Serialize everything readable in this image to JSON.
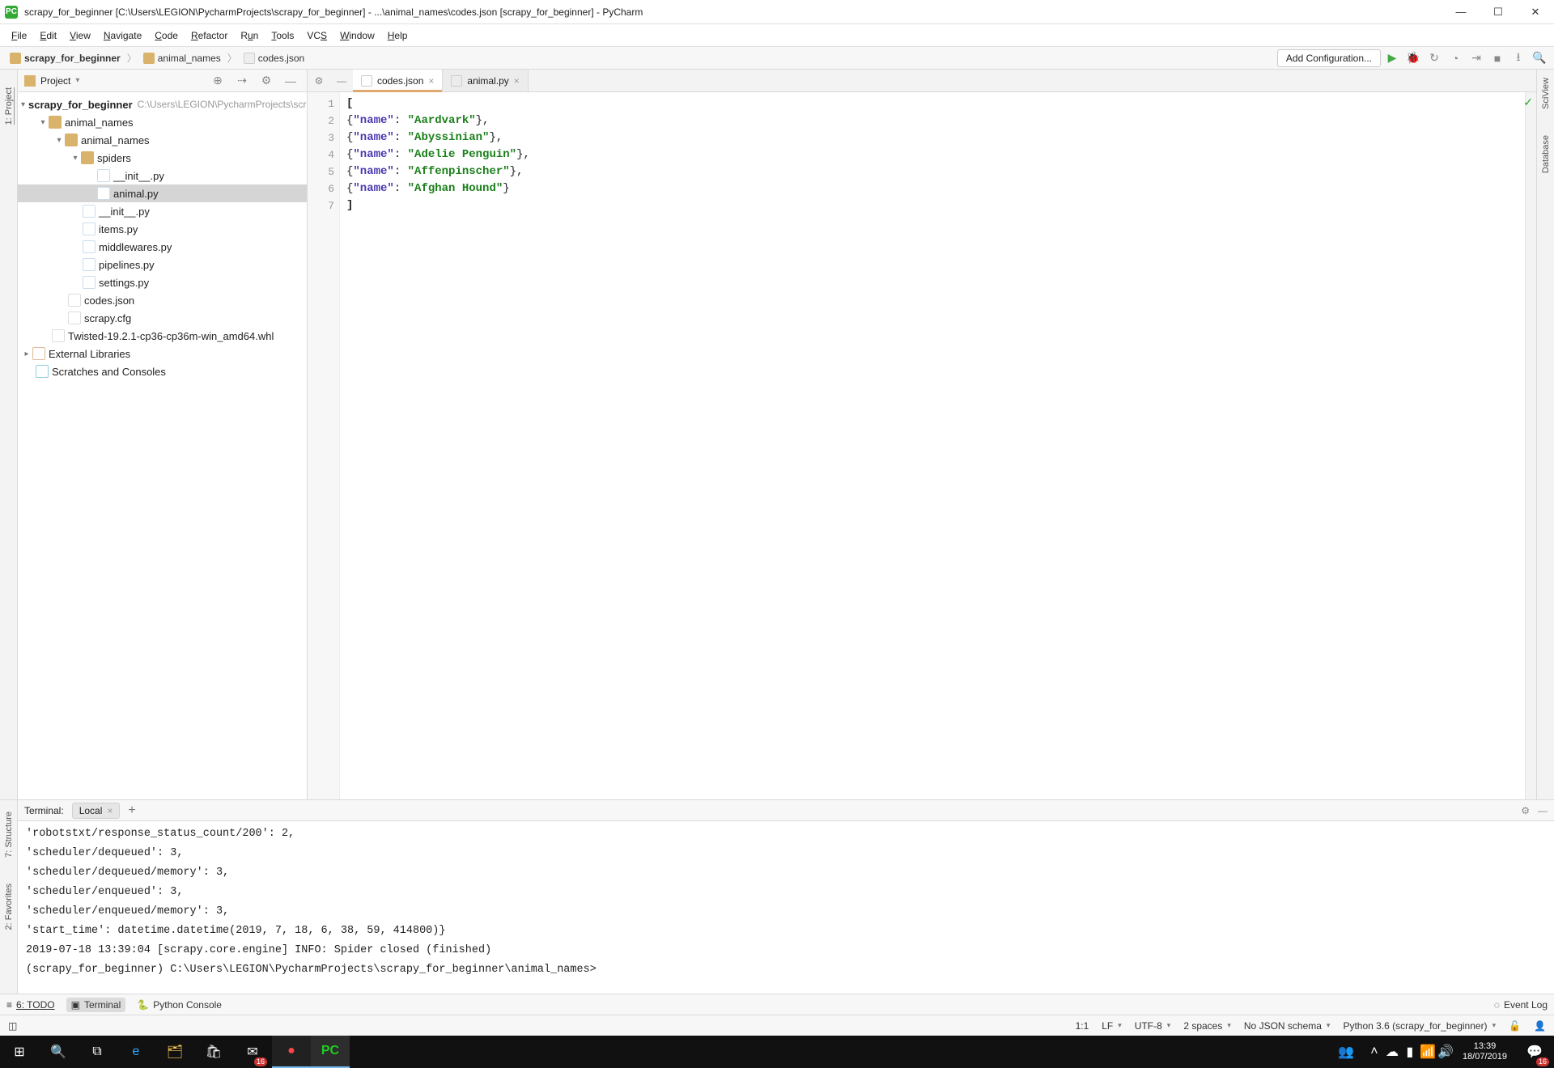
{
  "titlebar": {
    "appicon": "PC",
    "text": "scrapy_for_beginner [C:\\Users\\LEGION\\PycharmProjects\\scrapy_for_beginner] - ...\\animal_names\\codes.json [scrapy_for_beginner] - PyCharm"
  },
  "menu": [
    "File",
    "Edit",
    "View",
    "Navigate",
    "Code",
    "Refactor",
    "Run",
    "Tools",
    "VCS",
    "Window",
    "Help"
  ],
  "breadcrumb": {
    "root": "scrapy_for_beginner",
    "mid": "animal_names",
    "file": "codes.json",
    "addconf": "Add Configuration..."
  },
  "left_gutter": {
    "project": "1: Project"
  },
  "right_gutter": {
    "scv": "SciView",
    "db": "Database"
  },
  "project_header": {
    "name": "Project",
    "icons": {
      "locate": "⊕",
      "collapse": "⇢",
      "settings": "⚙",
      "hide": "—"
    }
  },
  "tree": {
    "root": "scrapy_for_beginner",
    "root_path": "C:\\Users\\LEGION\\PycharmProjects\\scrapy…",
    "n1": "animal_names",
    "n2": "animal_names",
    "n3": "spiders",
    "init": "__init__.py",
    "animal": "animal.py",
    "init2": "__init__.py",
    "items": "items.py",
    "middle": "middlewares.py",
    "pipe": "pipelines.py",
    "sett": "settings.py",
    "codes": "codes.json",
    "cfg": "scrapy.cfg",
    "twisted": "Twisted-19.2.1-cp36-cp36m-win_amd64.whl",
    "extlib": "External Libraries",
    "scratch": "Scratches and Consoles"
  },
  "tabs": {
    "t1": "codes.json",
    "t2": "animal.py"
  },
  "code": {
    "lines": [
      "1",
      "2",
      "3",
      "4",
      "5",
      "6",
      "7"
    ],
    "l1a": "[",
    "l7a": "]",
    "open": "{",
    "close": "},",
    "closeLast": "}",
    "key": "\"name\"",
    "colon": ": ",
    "v1": "\"Aardvark\"",
    "v2": "\"Abyssinian\"",
    "v3": "\"Adelie Penguin\"",
    "v4": "\"Affenpinscher\"",
    "v5": "\"Afghan Hound\""
  },
  "term_left": {
    "structure": "7: Structure",
    "fav": "2: Favorites"
  },
  "term_head": {
    "title": "Terminal:",
    "tab": "Local"
  },
  "terminal_lines": [
    " 'robotstxt/response_status_count/200': 2,",
    " 'scheduler/dequeued': 3,",
    " 'scheduler/dequeued/memory': 3,",
    " 'scheduler/enqueued': 3,",
    " 'scheduler/enqueued/memory': 3,",
    " 'start_time': datetime.datetime(2019, 7, 18, 6, 38, 59, 414800)}",
    "2019-07-18 13:39:04 [scrapy.core.engine] INFO: Spider closed (finished)",
    "",
    "(scrapy_for_beginner) C:\\Users\\LEGION\\PycharmProjects\\scrapy_for_beginner\\animal_names>"
  ],
  "toolwins": {
    "todo": "6: TODO",
    "term": "Terminal",
    "pyc": "Python Console",
    "evlog": "Event Log"
  },
  "status": {
    "pos": "1:1",
    "le": "LF",
    "enc": "UTF-8",
    "indent": "2 spaces",
    "schema": "No JSON schema",
    "interp": "Python 3.6 (scrapy_for_beginner)"
  },
  "taskbar": {
    "badge": "16",
    "time": "13:39",
    "date": "18/07/2019"
  }
}
